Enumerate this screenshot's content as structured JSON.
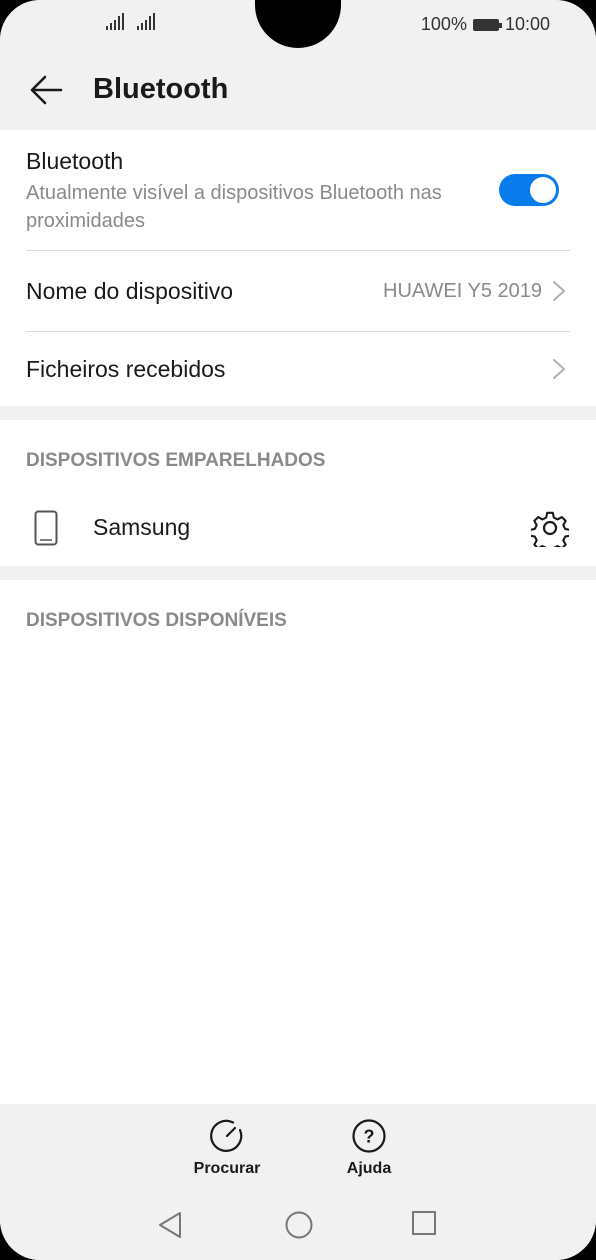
{
  "status_bar": {
    "battery": "100%",
    "time": "10:00"
  },
  "app_bar": {
    "title": "Bluetooth",
    "back_icon": "arrow-left-icon"
  },
  "bluetooth_settings": {
    "toggle_title": "Bluetooth",
    "toggle_subtitle": "Atualmente visível a dispositivos Bluetooth nas proximidades",
    "toggle_on": true,
    "device_name_label": "Nome do dispositivo",
    "device_name_value": "HUAWEI Y5 2019",
    "received_files_label": "Ficheiros recebidos"
  },
  "paired_devices": {
    "header": "DISPOSITIVOS EMPARELHADOS",
    "items": [
      {
        "name": "Samsung",
        "icon": "phone-icon",
        "action_icon": "gear-icon"
      }
    ]
  },
  "available_devices": {
    "header": "DISPOSITIVOS DISPONÍVEIS",
    "items": []
  },
  "toolbar": {
    "search_label": "Procurar",
    "help_label": "Ajuda"
  },
  "nav_bar": {
    "icons": [
      "nav-back-icon",
      "nav-home-icon",
      "nav-recents-icon"
    ]
  },
  "colors": {
    "accent": "#0a7bea",
    "background": "#f1f1f1",
    "card": "#ffffff",
    "secondary_text": "#8a8a8a"
  }
}
